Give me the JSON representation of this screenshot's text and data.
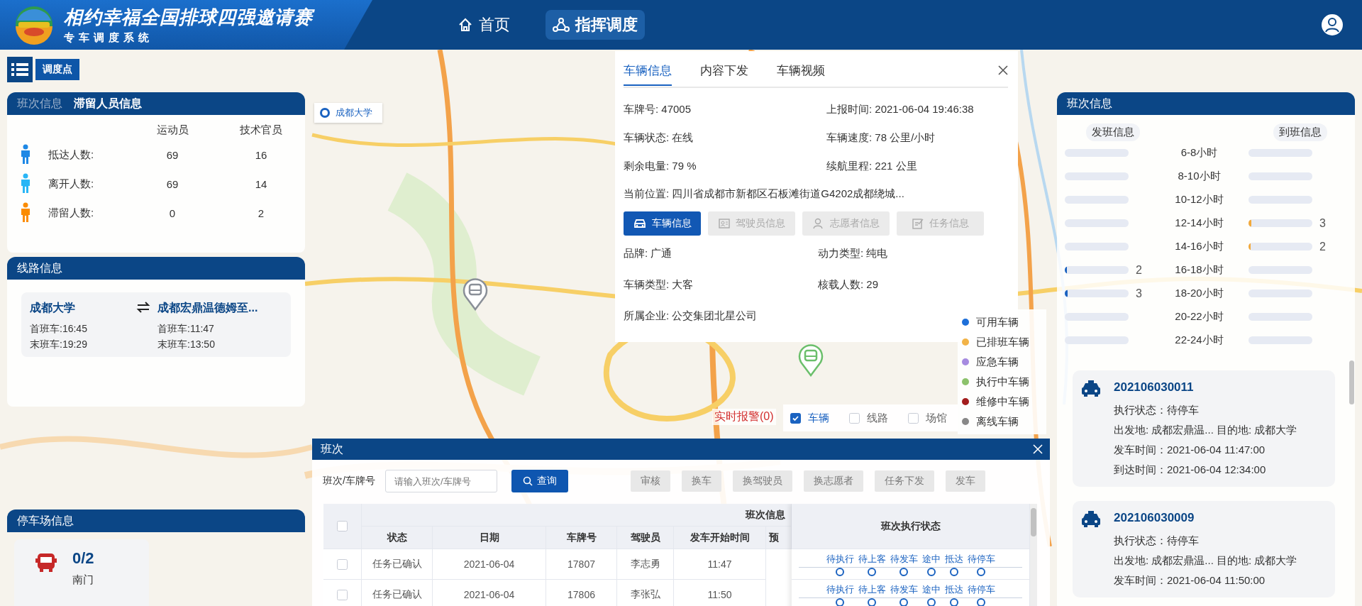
{
  "header": {
    "title": "相约幸福全国排球四强邀请赛",
    "subtitle": "专车调度系统",
    "nav": [
      {
        "label": "首页",
        "selected": false
      },
      {
        "label": "指挥调度",
        "selected": true
      }
    ]
  },
  "map_toolbar": {
    "dispatch_point_button": "调度点"
  },
  "map": {
    "place_marker": "成都大学",
    "alarm": "实时报警(0)",
    "layers": [
      {
        "label": "车辆",
        "checked": true
      },
      {
        "label": "线路",
        "checked": false
      },
      {
        "label": "场馆",
        "checked": false
      }
    ],
    "legend": [
      {
        "label": "可用车辆",
        "color": "#1e6fd9"
      },
      {
        "label": "已排班车辆",
        "color": "#f2b347"
      },
      {
        "label": "应急车辆",
        "color": "#a68be0"
      },
      {
        "label": "执行中车辆",
        "color": "#8cc26c"
      },
      {
        "label": "维修中车辆",
        "color": "#a31d1d"
      },
      {
        "label": "离线车辆",
        "color": "#888888"
      }
    ]
  },
  "stranded_panel": {
    "tabs": [
      {
        "label": "班次信息",
        "selected": false
      },
      {
        "label": "滞留人员信息",
        "selected": true
      }
    ],
    "columns": [
      "运动员",
      "技术官员"
    ],
    "rows": [
      {
        "label": "抵达人数:",
        "color": "#1e88e5",
        "athletes": "69",
        "officials": "16"
      },
      {
        "label": "离开人数:",
        "color": "#29b6f6",
        "athletes": "69",
        "officials": "14"
      },
      {
        "label": "滞留人数:",
        "color": "#fb8c00",
        "athletes": "0",
        "officials": "2"
      }
    ]
  },
  "route_panel": {
    "title": "线路信息",
    "routes": [
      {
        "from": "成都大学",
        "to": "成都宏鼎温德姆至...",
        "from_first": "首班车:16:45",
        "from_last": "末班车:19:29",
        "to_first": "首班车:11:47",
        "to_last": "末班车:13:50"
      }
    ]
  },
  "parking_panel": {
    "title": "停车场信息",
    "lots": [
      {
        "count": "0/2",
        "name": "南门"
      }
    ]
  },
  "vehicle_popup": {
    "tabs": [
      {
        "label": "车辆信息",
        "selected": true
      },
      {
        "label": "内容下发",
        "selected": false
      },
      {
        "label": "车辆视频",
        "selected": false
      }
    ],
    "status_fields": [
      "车牌号: 47005",
      "上报时间: 2021-06-04 19:46:38",
      "车辆状态: 在线",
      "车辆速度: 78 公里/小时",
      "剩余电量: 79 %",
      "续航里程: 221 公里"
    ],
    "location": "当前位置: 四川省成都市新都区石板滩街道G4202成都绕城...",
    "buttons": [
      {
        "label": "车辆信息",
        "selected": true
      },
      {
        "label": "驾驶员信息",
        "selected": false
      },
      {
        "label": "志愿者信息",
        "selected": false
      },
      {
        "label": "任务信息",
        "selected": false
      }
    ],
    "detail_fields": [
      "品牌: 广通",
      "动力类型: 纯电",
      "车辆类型: 大客",
      "核载人数: 29",
      "所属企业: 公交集团北星公司"
    ]
  },
  "schedule_dialog": {
    "title": "班次",
    "search_label": "班次/车牌号",
    "search": {
      "placeholder": "请输入班次/车牌号"
    },
    "query_button": "查询",
    "actions": [
      {
        "label": "审核",
        "disabled": true
      },
      {
        "label": "换车",
        "disabled": true
      },
      {
        "label": "换驾驶员",
        "disabled": true
      },
      {
        "label": "换志愿者",
        "disabled": true
      },
      {
        "label": "任务下发",
        "disabled": true
      },
      {
        "label": "发车",
        "disabled": true
      }
    ],
    "table": {
      "select_all_checked": false,
      "group_header": "班次信息",
      "status_header": "班次执行状态",
      "columns": [
        "状态",
        "日期",
        "车牌号",
        "驾驶员",
        "发车开始时间",
        "预"
      ],
      "rows": [
        {
          "selected": false,
          "cells": [
            "任务已确认",
            "2021-06-04",
            "17807",
            "李志勇",
            "11:47"
          ],
          "steps": [
            "待执行",
            "待上客",
            "待发车",
            "途中",
            "抵达",
            "待停车"
          ]
        },
        {
          "selected": false,
          "cells": [
            "任务已确认",
            "2021-06-04",
            "17806",
            "李张弘",
            "11:50"
          ],
          "steps": [
            "待执行",
            "待上客",
            "待发车",
            "途中",
            "抵达",
            "待停车"
          ]
        }
      ]
    }
  },
  "schedule_panel": {
    "title": "班次信息",
    "departure_header": "发班信息",
    "arrival_header": "到班信息",
    "periods": [
      {
        "label": "6-8小时"
      },
      {
        "label": "8-10小时"
      },
      {
        "label": "10-12小时"
      },
      {
        "label": "12-14小时",
        "arrival": {
          "level": 0.04,
          "count": "3"
        }
      },
      {
        "label": "14-16小时",
        "arrival": {
          "level": 0.03,
          "count": "2"
        }
      },
      {
        "label": "16-18小时",
        "departure": {
          "level": 0.03,
          "count": "2"
        }
      },
      {
        "label": "18-20小时",
        "departure": {
          "level": 0.04,
          "count": "3"
        }
      },
      {
        "label": "20-22小时"
      },
      {
        "label": "22-24小时"
      }
    ],
    "trips": [
      {
        "id": "202106030011",
        "status": "执行状态：待停车",
        "origin": "出发地: 成都宏鼎温...",
        "destination": "目的地: 成都大学",
        "depart_time": "发车时间：2021-06-04 11:47:00",
        "arrive_time": "到达时间：2021-06-04 12:34:00"
      },
      {
        "id": "202106030009",
        "status": "执行状态：待停车",
        "origin": "出发地: 成都宏鼎温...",
        "destination": "目的地: 成都大学",
        "depart_time": "发车时间：2021-06-04 11:50:00"
      }
    ]
  }
}
